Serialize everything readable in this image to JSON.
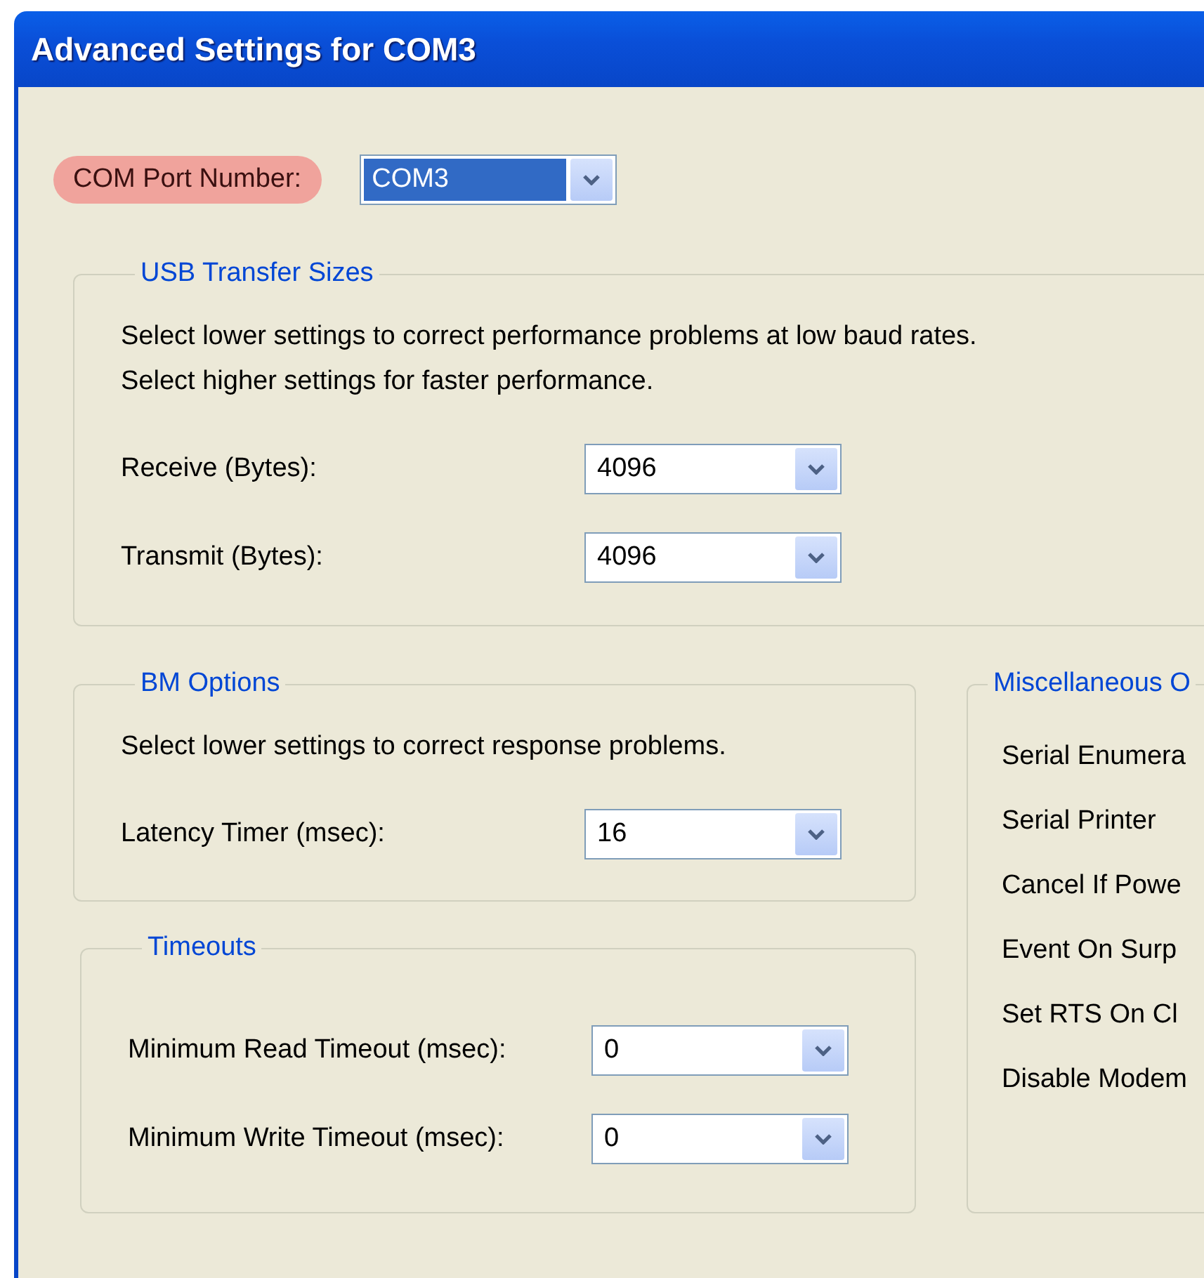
{
  "window": {
    "title": "Advanced Settings for COM3"
  },
  "com_port": {
    "label": "COM Port Number:",
    "highlighted": true,
    "value": "COM3",
    "focused": true
  },
  "usb_transfer_sizes": {
    "title": "USB Transfer Sizes",
    "description": [
      "Select lower settings to correct performance problems at low baud rates.",
      "Select higher settings for faster performance."
    ],
    "fields": [
      {
        "label": "Receive (Bytes):",
        "value": "4096"
      },
      {
        "label": "Transmit (Bytes):",
        "value": "4096"
      }
    ]
  },
  "bm_options": {
    "title": "BM Options",
    "description": [
      "Select lower settings to correct response problems."
    ],
    "fields": [
      {
        "label": "Latency Timer (msec):",
        "value": "16"
      }
    ]
  },
  "timeouts": {
    "title": "Timeouts",
    "fields": [
      {
        "label": "Minimum Read Timeout (msec):",
        "value": "0"
      },
      {
        "label": "Minimum Write Timeout (msec):",
        "value": "0"
      }
    ]
  },
  "miscellaneous": {
    "title": "Miscellaneous O",
    "items": [
      "Serial Enumera",
      "Serial Printer",
      "Cancel If Powe",
      "Event On Surp",
      "Set RTS On Cl",
      "Disable Modem"
    ]
  }
}
